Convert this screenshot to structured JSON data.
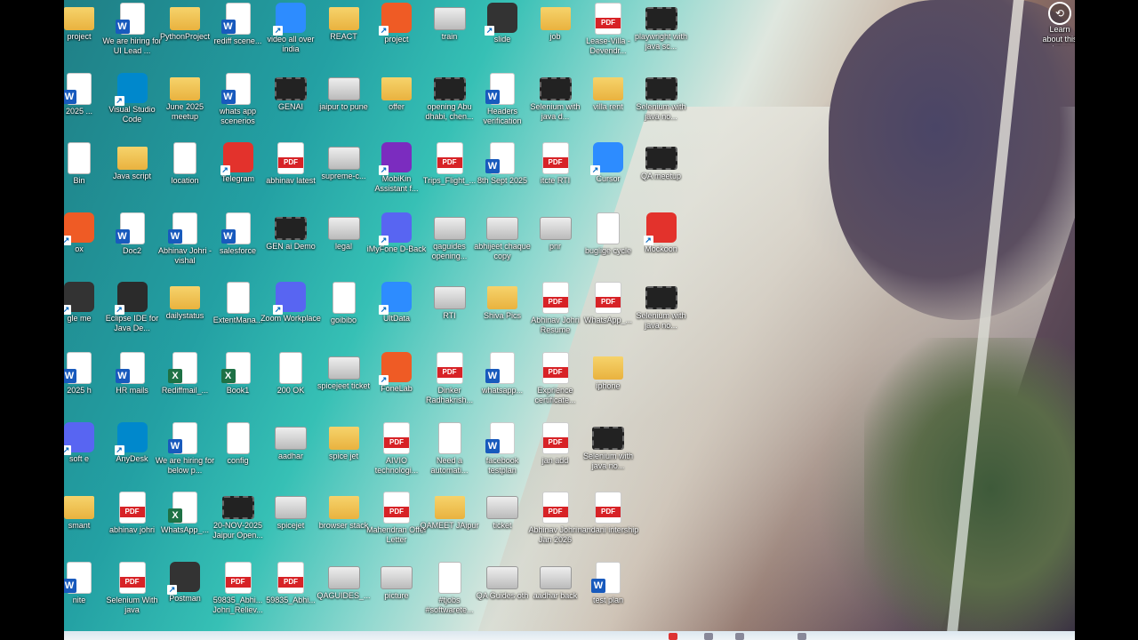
{
  "desktop": {
    "learn_more": "Learn about this picture",
    "icons": [
      {
        "label": "project",
        "type": "folder"
      },
      {
        "label": "We are hiring for UI Lead ...",
        "type": "word"
      },
      {
        "label": "PythonProject",
        "type": "folder"
      },
      {
        "label": "rediff scene...",
        "type": "word"
      },
      {
        "label": "video all over india",
        "type": "app"
      },
      {
        "label": "REACT",
        "type": "folder"
      },
      {
        "label": "project",
        "type": "app"
      },
      {
        "label": "train",
        "type": "img"
      },
      {
        "label": "slide",
        "type": "app"
      },
      {
        "label": "job",
        "type": "folder"
      },
      {
        "label": "Lease-Villa -Devendr...",
        "type": "pdf"
      },
      {
        "label": "playwright with java sc...",
        "type": "video"
      },
      {
        "label": "2025 ...",
        "type": "word"
      },
      {
        "label": "Visual Studio Code",
        "type": "app"
      },
      {
        "label": "June 2025 meetup",
        "type": "folder"
      },
      {
        "label": "whats app scenerios",
        "type": "word"
      },
      {
        "label": "GENAI",
        "type": "video"
      },
      {
        "label": "jaipur to pune",
        "type": "img"
      },
      {
        "label": "offer",
        "type": "folder"
      },
      {
        "label": "opening Abu dhabi, chen...",
        "type": "video"
      },
      {
        "label": "Headers verification",
        "type": "word"
      },
      {
        "label": "Selenium with java d...",
        "type": "video"
      },
      {
        "label": "villa rent",
        "type": "folder"
      },
      {
        "label": "Selenium with java no...",
        "type": "video"
      },
      {
        "label": "Bin",
        "type": "doc"
      },
      {
        "label": "Java script",
        "type": "folder"
      },
      {
        "label": "location",
        "type": "doc"
      },
      {
        "label": "Telegram",
        "type": "app"
      },
      {
        "label": "abhinav latest",
        "type": "pdf"
      },
      {
        "label": "supreme-c...",
        "type": "img"
      },
      {
        "label": "MobiKin Assistant f...",
        "type": "app"
      },
      {
        "label": "Trips_Flight_...",
        "type": "pdf"
      },
      {
        "label": "8th Sept 2025",
        "type": "word"
      },
      {
        "label": "itcte RTI",
        "type": "pdf"
      },
      {
        "label": "Cursor",
        "type": "app"
      },
      {
        "label": "QA meetup",
        "type": "video"
      },
      {
        "label": "ox",
        "type": "app"
      },
      {
        "label": "Doc2",
        "type": "word"
      },
      {
        "label": "Abhinav Johri - vishal",
        "type": "word"
      },
      {
        "label": "salesforce",
        "type": "word"
      },
      {
        "label": "GEN ai Demo",
        "type": "video"
      },
      {
        "label": "legal",
        "type": "img"
      },
      {
        "label": "iMyFone D-Back",
        "type": "app"
      },
      {
        "label": "qaguides opening...",
        "type": "img"
      },
      {
        "label": "abhijeet chaque copy",
        "type": "img"
      },
      {
        "label": "pnr",
        "type": "img"
      },
      {
        "label": "buglige cycle",
        "type": "doc"
      },
      {
        "label": "Mockoon",
        "type": "app"
      },
      {
        "label": "gle me",
        "type": "app"
      },
      {
        "label": "Eclipse IDE for Java De...",
        "type": "app"
      },
      {
        "label": "dailystatus",
        "type": "folder"
      },
      {
        "label": "ExtentMana...",
        "type": "doc"
      },
      {
        "label": "Zoom Workplace",
        "type": "app"
      },
      {
        "label": "goibibo",
        "type": "doc"
      },
      {
        "label": "UltData",
        "type": "app"
      },
      {
        "label": "RTI",
        "type": "img"
      },
      {
        "label": "Shiva Pics",
        "type": "folder"
      },
      {
        "label": "Abhinav Johri Resume",
        "type": "pdf"
      },
      {
        "label": "WhatsApp_...",
        "type": "pdf"
      },
      {
        "label": "Selenium with java no...",
        "type": "video"
      },
      {
        "label": "2025 h",
        "type": "word"
      },
      {
        "label": "HR mails",
        "type": "word"
      },
      {
        "label": "Rediffmail_...",
        "type": "excel"
      },
      {
        "label": "Book1",
        "type": "excel"
      },
      {
        "label": "200 OK",
        "type": "doc"
      },
      {
        "label": "spicejeet ticket",
        "type": "img"
      },
      {
        "label": "FoneLab",
        "type": "app"
      },
      {
        "label": "Dinker Radhakrish...",
        "type": "pdf"
      },
      {
        "label": "whatsapp...",
        "type": "word"
      },
      {
        "label": "Exprience certificate...",
        "type": "pdf"
      },
      {
        "label": "iphone",
        "type": "folder"
      },
      {
        "label": "",
        "type": "none"
      },
      {
        "label": "soft e",
        "type": "app"
      },
      {
        "label": "AnyDesk",
        "type": "app"
      },
      {
        "label": "We are hiring for below p...",
        "type": "word"
      },
      {
        "label": "config",
        "type": "doc"
      },
      {
        "label": "aadhar",
        "type": "img"
      },
      {
        "label": "spice jet",
        "type": "folder"
      },
      {
        "label": "AIVIO technologi...",
        "type": "pdf"
      },
      {
        "label": "Need a automati...",
        "type": "doc"
      },
      {
        "label": "facebook testplan",
        "type": "word"
      },
      {
        "label": "jan add",
        "type": "pdf"
      },
      {
        "label": "Selenium with java no...",
        "type": "video"
      },
      {
        "label": "",
        "type": "none"
      },
      {
        "label": "smant",
        "type": "folder"
      },
      {
        "label": "abhinav johri",
        "type": "pdf"
      },
      {
        "label": "WhatsApp_...",
        "type": "excel"
      },
      {
        "label": "20-NOV-2025 Jaipur Open...",
        "type": "video"
      },
      {
        "label": "spicejet",
        "type": "img"
      },
      {
        "label": "browser stack",
        "type": "folder"
      },
      {
        "label": "Mahendran Offer Letter",
        "type": "pdf"
      },
      {
        "label": "QAMEET JAipur",
        "type": "folder"
      },
      {
        "label": "ticket",
        "type": "img"
      },
      {
        "label": "Abhinav Johri - Jan 2026",
        "type": "pdf"
      },
      {
        "label": "nandani intership",
        "type": "pdf"
      },
      {
        "label": "",
        "type": "none"
      },
      {
        "label": "nite",
        "type": "word"
      },
      {
        "label": "Selenium With java",
        "type": "pdf"
      },
      {
        "label": "Postman",
        "type": "app"
      },
      {
        "label": "59835_Abhi... Johri_Reliev...",
        "type": "pdf"
      },
      {
        "label": "59835_Abhi...",
        "type": "pdf"
      },
      {
        "label": "QAGUIDES_...",
        "type": "img"
      },
      {
        "label": "picture",
        "type": "img"
      },
      {
        "label": "#tjobs #softwarete...",
        "type": "doc"
      },
      {
        "label": "QA Guides oth",
        "type": "img"
      },
      {
        "label": "aadhar back",
        "type": "img"
      },
      {
        "label": "test plan",
        "type": "word"
      },
      {
        "label": "",
        "type": "none"
      }
    ]
  },
  "colors": {
    "word": "#185abd",
    "pdf": "#d72226",
    "excel": "#1e7145",
    "folder": "#f0c452"
  }
}
